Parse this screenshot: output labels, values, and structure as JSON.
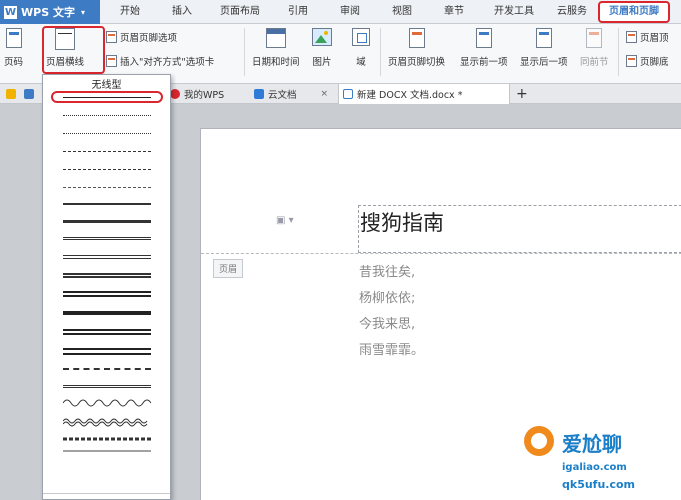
{
  "app": {
    "name": "WPS 文字",
    "logo_letter": "W",
    "caret": "▾"
  },
  "menu": {
    "tabs": [
      "开始",
      "插入",
      "页面布局",
      "引用",
      "审阅",
      "视图",
      "章节",
      "开发工具",
      "云服务",
      "页眉和页脚"
    ],
    "active_tab": "页眉和页脚"
  },
  "ribbon": {
    "page_number": "页码",
    "header_line": "页眉横线",
    "header_footer_options": "页眉页脚选项",
    "insert_align_tab": "插入\"对齐方式\"选项卡",
    "date_time": "日期和时间",
    "picture": "图片",
    "field": "域",
    "switch": "页眉页脚切换",
    "show_prev": "显示前一项",
    "show_next": "显示后一项",
    "same_as_prev": "同前节",
    "header_top": "页眉顶",
    "footer_bottom": "页脚底"
  },
  "tabs": {
    "my_wps": "我的WPS",
    "cloud": "云文档",
    "doc": "新建 DOCX 文档.docx *",
    "add": "+",
    "close": "×"
  },
  "dropdown": {
    "title": "无线型"
  },
  "document": {
    "title": "搜狗指南",
    "header_label": "页眉",
    "poem": [
      "昔我往矣,",
      "杨柳依依;",
      "今我来思,",
      "雨雪霏霏。"
    ]
  },
  "watermark": {
    "cn": "爱尬聊",
    "domain1": "igaliao.com",
    "domain2": "qk5ufu.com"
  },
  "colors": {
    "accent": "#3d7bc4",
    "highlight": "#d9262f"
  }
}
